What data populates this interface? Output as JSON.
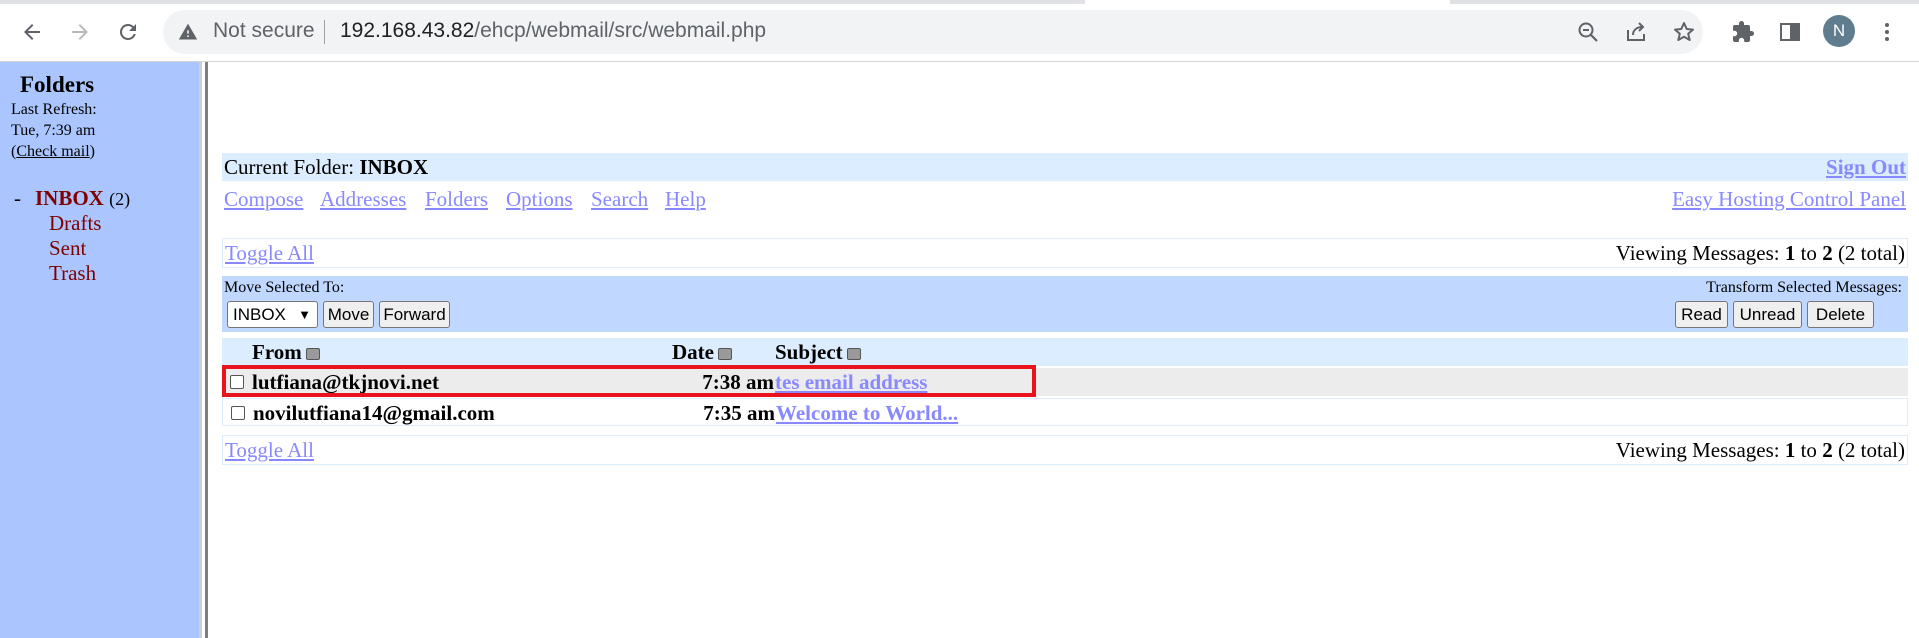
{
  "browser": {
    "security_label": "Not secure",
    "url_host": "192.168.43.82",
    "url_path": "/ehcp/webmail/src/webmail.php",
    "profile_initial": "N",
    "icons": [
      "back-icon",
      "forward-icon",
      "reload-icon",
      "warning-icon",
      "zoom-out-icon",
      "share-icon",
      "star-icon",
      "extensions-icon",
      "side-panel-icon",
      "menu-dots-icon"
    ]
  },
  "folders_pane": {
    "title": "Folders",
    "last_refresh_label": "Last Refresh:",
    "last_refresh_time": "Tue, 7:39 am",
    "check_mail_prefix": "(",
    "check_mail_link": "Check mail",
    "check_mail_suffix": ")",
    "inbox": {
      "dash": "-",
      "name": "INBOX",
      "count": "(2)"
    },
    "items": [
      {
        "label": "Drafts"
      },
      {
        "label": "Sent"
      },
      {
        "label": "Trash"
      }
    ]
  },
  "header": {
    "current_folder_label": "Current Folder:",
    "current_folder_name": "INBOX",
    "sign_out": "Sign Out",
    "menu": [
      "Compose",
      "Addresses",
      "Folders",
      "Options",
      "Search",
      "Help"
    ],
    "ehcp_link": "Easy Hosting Control Panel"
  },
  "list_controls": {
    "toggle_all": "Toggle All",
    "viewing_prefix": "Viewing Messages: ",
    "viewing_from": "1",
    "viewing_to_word": " to ",
    "viewing_to": "2",
    "viewing_total": " (2 total)"
  },
  "actions": {
    "move_label": "Move Selected To:",
    "move_select_value": "INBOX",
    "move_button": "Move",
    "forward_button": "Forward",
    "transform_label": "Transform Selected Messages:",
    "read_button": "Read",
    "unread_button": "Unread",
    "delete_button": "Delete"
  },
  "table": {
    "columns": [
      "From",
      "Date",
      "Subject"
    ],
    "rows": [
      {
        "from": "lutfiana@tkjnovi.net",
        "date": "7:38 am",
        "subject": "tes email address",
        "highlighted": true
      },
      {
        "from": "novilutfiana14@gmail.com",
        "date": "7:35 am",
        "subject": "Welcome to World...",
        "highlighted": false
      }
    ]
  },
  "colors": {
    "left_pane": "#abc6ff",
    "link": "#8888ff",
    "folder_text": "#800000",
    "bar_light": "#dcedff",
    "action_bar": "#c0d8ff",
    "highlight_border": "#e8131c",
    "row_highlight_bg": "#ececec"
  }
}
